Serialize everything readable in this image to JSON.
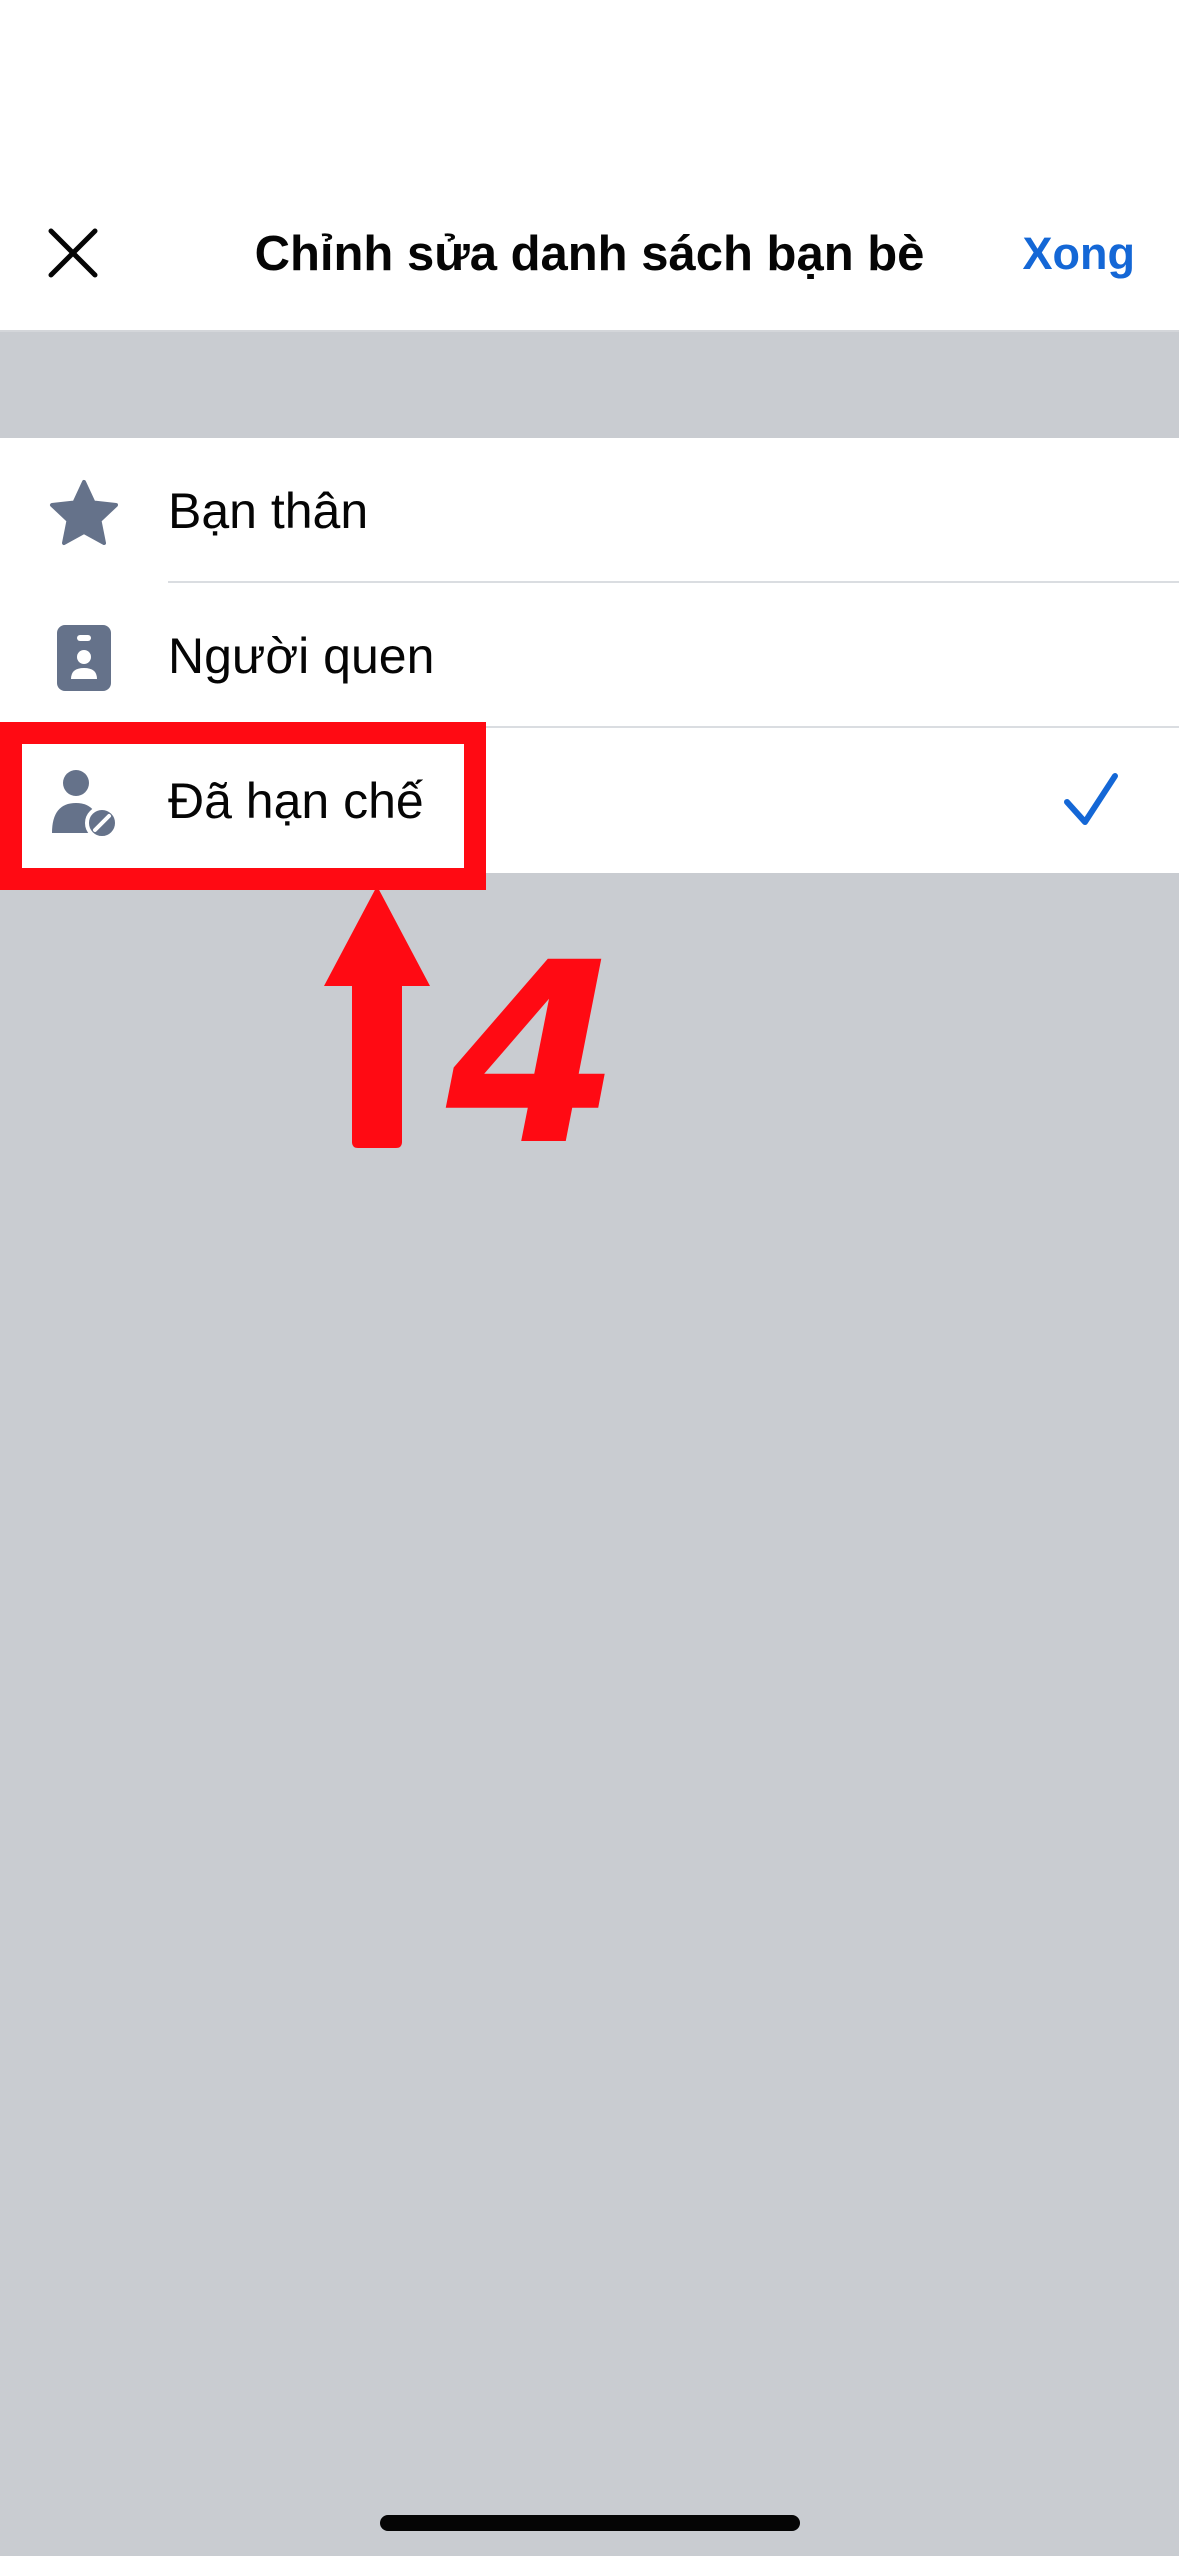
{
  "header": {
    "title": "Chỉnh sửa danh sách bạn bè",
    "done_label": "Xong",
    "close_icon": "close-icon"
  },
  "lists": [
    {
      "label": "Bạn thân",
      "icon": "star-icon",
      "selected": false
    },
    {
      "label": "Người quen",
      "icon": "id-badge-icon",
      "selected": false
    },
    {
      "label": "Đã hạn chế",
      "icon": "restricted-person-icon",
      "selected": true
    }
  ],
  "annotation": {
    "step_number": "4",
    "color": "#ff0a13"
  },
  "colors": {
    "accent": "#1467d6",
    "icon_gray": "#65728a",
    "background": "#c9ccd1"
  }
}
